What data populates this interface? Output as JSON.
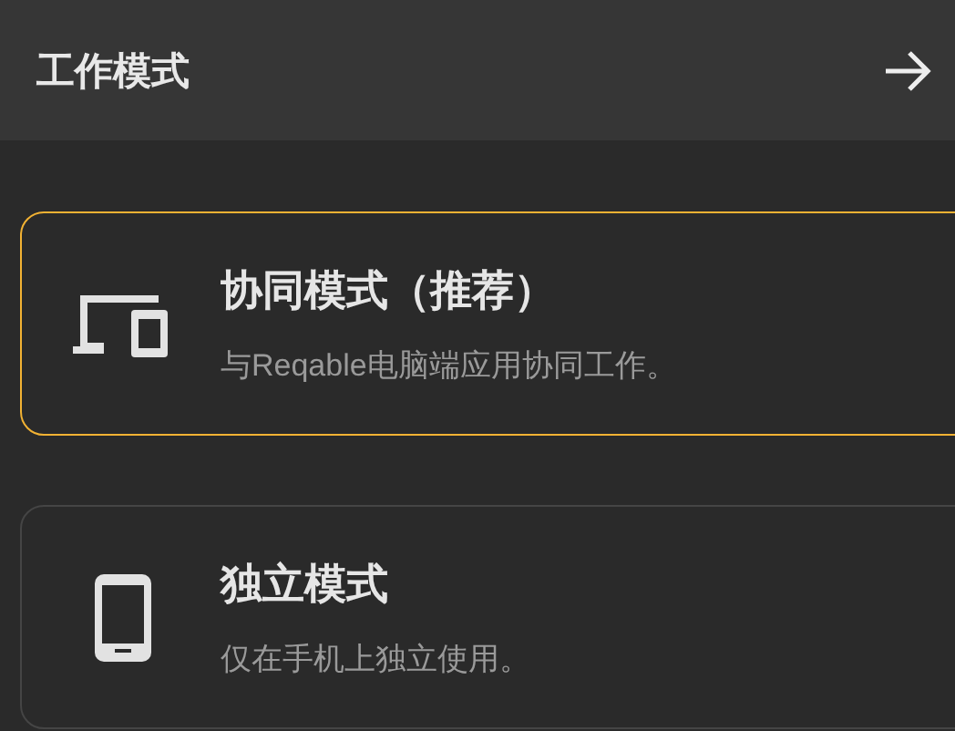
{
  "header": {
    "title": "工作模式"
  },
  "modes": [
    {
      "kind": "desktop",
      "title": "协同模式（推荐）",
      "description": "与Reqable电脑端应用协同工作。",
      "selected": true
    },
    {
      "kind": "phone",
      "title": "独立模式",
      "description": "仅在手机上独立使用。",
      "selected": false
    }
  ]
}
